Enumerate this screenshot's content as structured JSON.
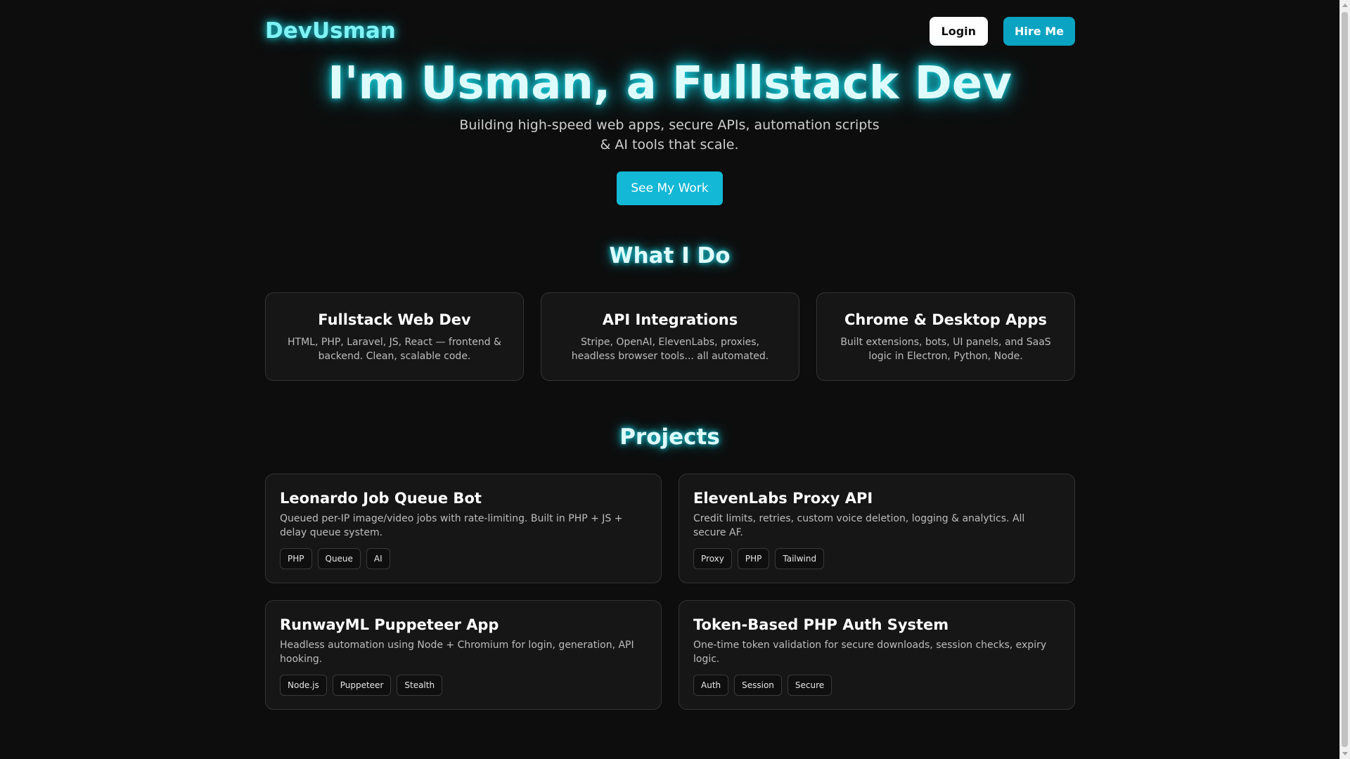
{
  "nav": {
    "logo": "DevUsman",
    "login_label": "Login",
    "hire_label": "Hire Me"
  },
  "hero": {
    "title": "I'm Usman, a Fullstack Dev",
    "subtitle_line1": "Building high-speed web apps, secure APIs, automation scripts",
    "subtitle_line2": "& AI tools that scale.",
    "cta_label": "See My Work"
  },
  "services": {
    "title": "What I Do",
    "items": [
      {
        "title": "Fullstack Web Dev",
        "desc_line1": "HTML, PHP, Laravel, JS, React — frontend &",
        "desc_line2": "backend. Clean, scalable code."
      },
      {
        "title": "API Integrations",
        "desc_line1": "Stripe, OpenAI, ElevenLabs, proxies,",
        "desc_line2": "headless browser tools... all automated."
      },
      {
        "title": "Chrome & Desktop Apps",
        "desc_line1": "Built extensions, bots, UI panels, and SaaS",
        "desc_line2": "logic in Electron, Python, Node."
      }
    ]
  },
  "projects": {
    "title": "Projects",
    "items": [
      {
        "title": "Leonardo Job Queue Bot",
        "desc_line1": "Queued per-IP image/video jobs with rate-limiting. Built in PHP + JS +",
        "desc_line2": "delay queue system.",
        "tags": [
          "PHP",
          "Queue",
          "AI"
        ]
      },
      {
        "title": "ElevenLabs Proxy API",
        "desc_line1": "Credit limits, retries, custom voice deletion, logging & analytics. All",
        "desc_line2": "secure AF.",
        "tags": [
          "Proxy",
          "PHP",
          "Tailwind"
        ]
      },
      {
        "title": "RunwayML Puppeteer App",
        "desc_line1": "Headless automation using Node + Chromium for login, generation, API",
        "desc_line2": "hooking.",
        "tags": [
          "Node.js",
          "Puppeteer",
          "Stealth"
        ]
      },
      {
        "title": "Token-Based PHP Auth System",
        "desc_line1": "One-time token validation for secure downloads, session checks, expiry",
        "desc_line2": "logic.",
        "tags": [
          "Auth",
          "Session",
          "Secure"
        ]
      }
    ]
  }
}
